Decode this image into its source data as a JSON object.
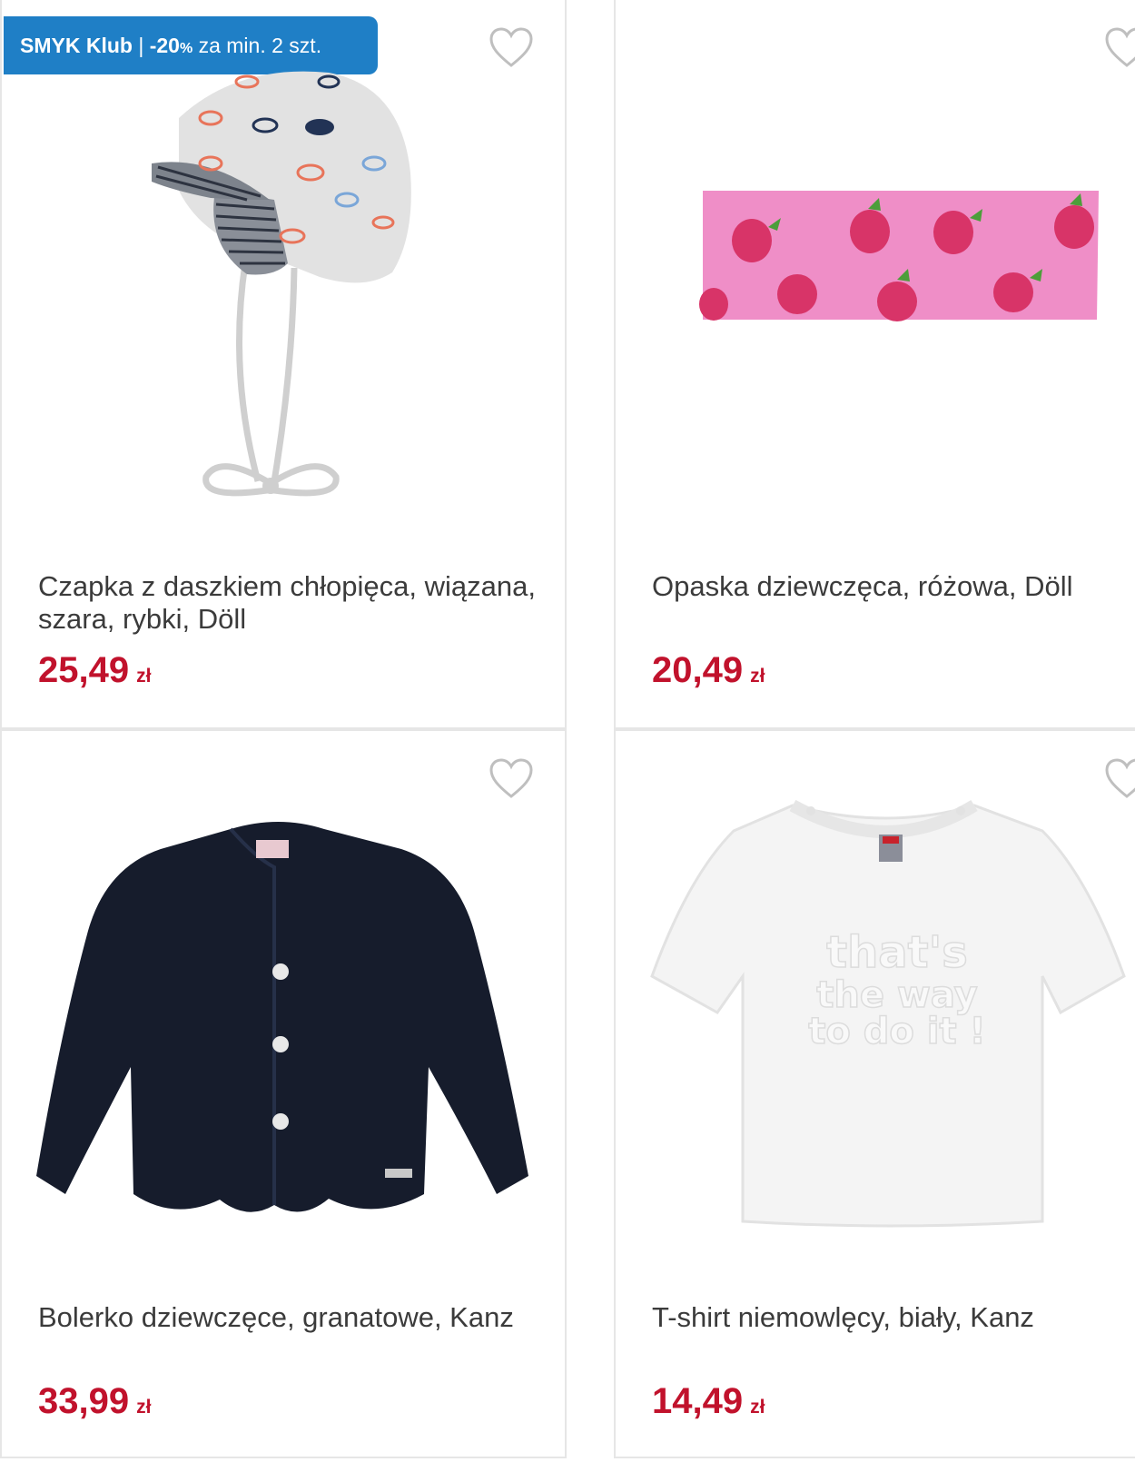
{
  "promo_badge": {
    "brand": "SMYK Klub",
    "separator": "|",
    "discount": "-20",
    "percent": "%",
    "condition": "za min. 2 szt.",
    "color": "#1f7fc6"
  },
  "currency": "zł",
  "price_color": "#c1122c",
  "products": [
    {
      "title": "Czapka z daszkiem chłopięca, wiązana, szara, rybki, Döll",
      "price": "25,49",
      "image": "grey-fish-cap"
    },
    {
      "title": "Opaska dziewczęca, różowa, Döll",
      "price": "20,49",
      "image": "pink-strawberry-headband"
    },
    {
      "title": "Bolerko dziewczęce, granatowe, Kanz",
      "price": "33,99",
      "image": "navy-bolero"
    },
    {
      "title": "T-shirt niemowlęcy, biały, Kanz",
      "price": "14,49",
      "image": "white-tshirt"
    }
  ],
  "tshirt_print": [
    "that's",
    "the way",
    "to do it !"
  ]
}
